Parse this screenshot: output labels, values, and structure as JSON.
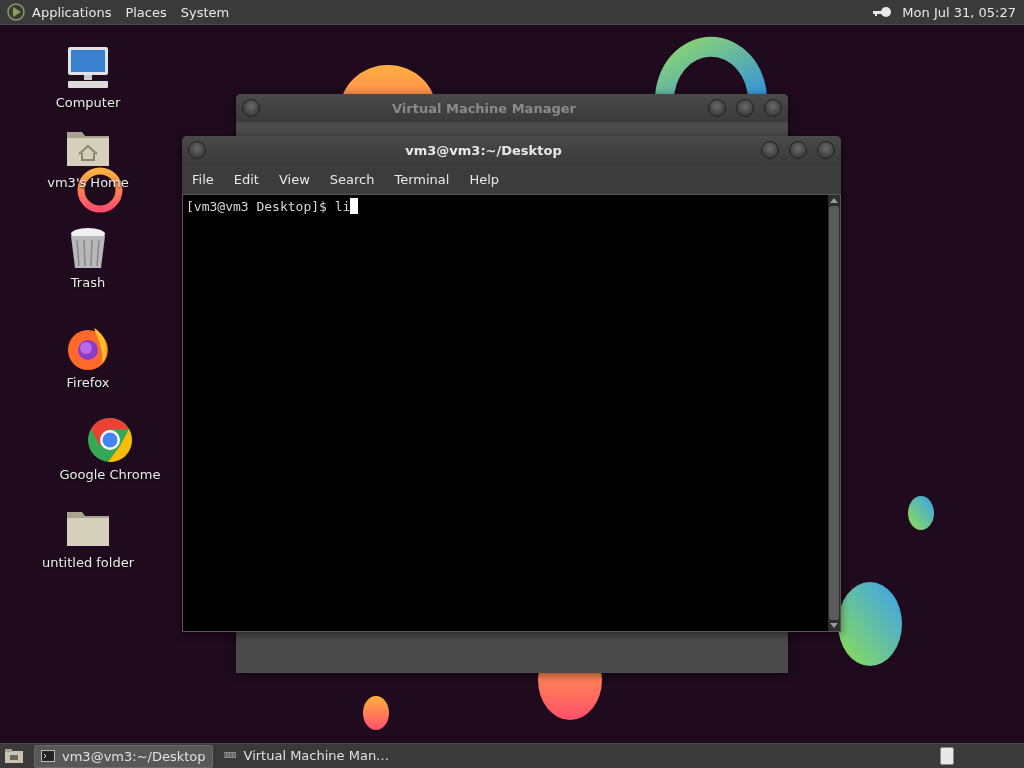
{
  "top_panel": {
    "menus": [
      "Applications",
      "Places",
      "System"
    ],
    "clock": "Mon Jul 31, 05:27"
  },
  "desktop_icons": [
    {
      "label": "Computer",
      "kind": "computer"
    },
    {
      "label": "vm3's Home",
      "kind": "home"
    },
    {
      "label": "Trash",
      "kind": "trash"
    },
    {
      "label": "Firefox",
      "kind": "firefox"
    },
    {
      "label": "Google Chrome",
      "kind": "chrome"
    },
    {
      "label": "untitled folder",
      "kind": "folder"
    }
  ],
  "vmm_window": {
    "title": "Virtual Machine Manager"
  },
  "terminal_window": {
    "title": "vm3@vm3:~/Desktop",
    "menus": [
      "File",
      "Edit",
      "View",
      "Search",
      "Terminal",
      "Help"
    ],
    "lines": [
      "[vm3@vm3 Desktop]$ li"
    ]
  },
  "taskbar": {
    "tasks": [
      {
        "label": "vm3@vm3:~/Desktop",
        "kind": "terminal",
        "selected": true
      },
      {
        "label": "Virtual Machine Man…",
        "kind": "vmm",
        "selected": false
      }
    ]
  }
}
